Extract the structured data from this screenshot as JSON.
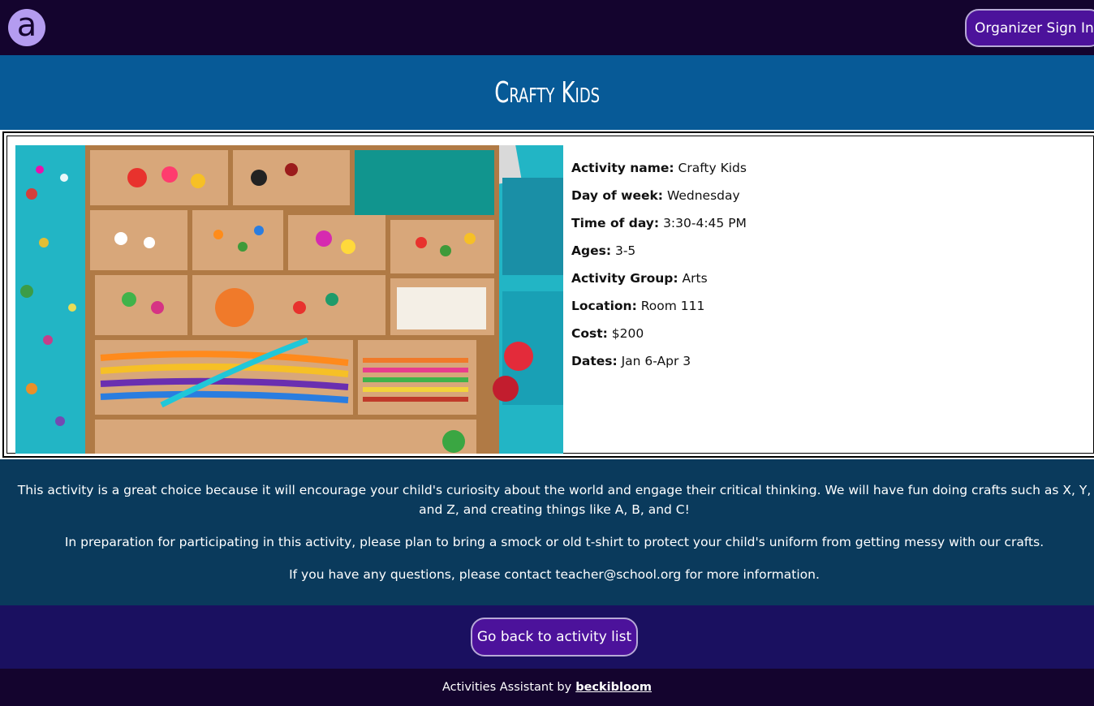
{
  "header": {
    "logo_letter": "a",
    "signin_label": "Organizer Sign In"
  },
  "banner": {
    "title": "Crafty Kids"
  },
  "details": [
    {
      "label": "Activity name:",
      "value": "Crafty Kids"
    },
    {
      "label": "Day of week:",
      "value": "Wednesday"
    },
    {
      "label": "Time of day:",
      "value": "3:30-4:45 PM"
    },
    {
      "label": "Ages:",
      "value": "3-5"
    },
    {
      "label": "Activity Group:",
      "value": "Arts"
    },
    {
      "label": "Location:",
      "value": "Room 111"
    },
    {
      "label": "Cost:",
      "value": "$200"
    },
    {
      "label": "Dates:",
      "value": "Jan 6-Apr 3"
    }
  ],
  "description": {
    "p1": "This activity is a great choice because it will encourage your child's curiosity about the world and engage their critical thinking. We will have fun doing crafts such as X, Y, and Z, and creating things like A, B, and C!",
    "p2": "In preparation for participating in this activity, please plan to bring a smock or old t-shirt to protect your child's uniform from getting messy with our crafts.",
    "p3": "If you have any questions, please contact teacher@school.org for more information."
  },
  "back": {
    "label": "Go back to activity list"
  },
  "footer": {
    "text": "Activities Assistant by",
    "link": "beckibloom"
  },
  "colors": {
    "topbar": "#14042e",
    "banner": "#075a97",
    "description_bg": "#0a3a5c",
    "backbar": "#1a1060",
    "button": "#4c129b",
    "logo": "#b49cf0"
  }
}
